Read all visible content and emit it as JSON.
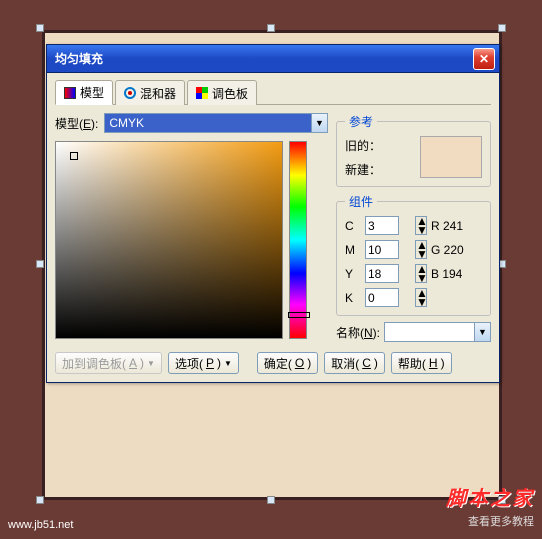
{
  "dialog": {
    "title": "均匀填充",
    "close": "✕"
  },
  "tabs": {
    "model": "模型",
    "mixer": "混和器",
    "palette": "调色板"
  },
  "model_row": {
    "label_pre": "模型(",
    "label_u": "E",
    "label_post": "):",
    "value": "CMYK"
  },
  "reference": {
    "legend": "参考",
    "old_label": "旧的：",
    "new_label": "新建：",
    "swatch_hex": "#f1dcc2"
  },
  "components": {
    "legend": "组件",
    "rows": [
      {
        "ch": "C",
        "val": "3"
      },
      {
        "ch": "M",
        "val": "10"
      },
      {
        "ch": "Y",
        "val": "18"
      },
      {
        "ch": "K",
        "val": "0"
      }
    ],
    "rgb": [
      {
        "ch": "R",
        "val": "241"
      },
      {
        "ch": "G",
        "val": "220"
      },
      {
        "ch": "B",
        "val": "194"
      }
    ]
  },
  "name_row": {
    "label_pre": "名称(",
    "label_u": "N",
    "label_post": "):",
    "value": ""
  },
  "buttons": {
    "add_palette_pre": "加到调色板(",
    "add_palette_u": "A",
    "add_palette_post": ")",
    "options_pre": "选项(",
    "options_u": "P",
    "options_post": ")",
    "ok_pre": "确定(",
    "ok_u": "O",
    "ok_post": ")",
    "cancel_pre": "取消(",
    "cancel_u": "C",
    "cancel_post": ")",
    "help_pre": "帮助(",
    "help_u": "H",
    "help_post": ")"
  },
  "watermarks": {
    "w1": "脚本之家",
    "w2": "查看更多教程",
    "w3": "www.jb51.net"
  }
}
